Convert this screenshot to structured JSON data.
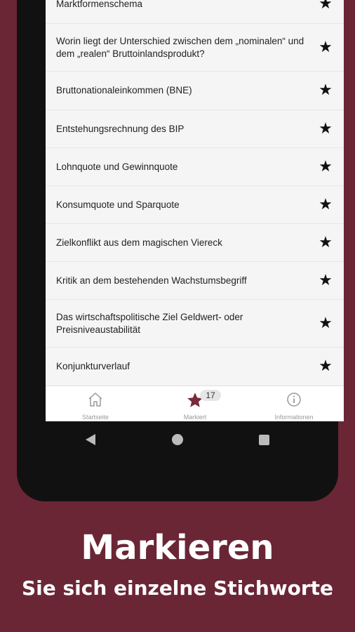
{
  "list": {
    "items": [
      {
        "label": ""
      },
      {
        "label": "Marktformenschema"
      },
      {
        "label": "Worin liegt der Unterschied zwischen dem „nominalen“ und dem „realen“ Bruttoinlandsprodukt?"
      },
      {
        "label": "Bruttonationaleinkommen (BNE)"
      },
      {
        "label": "Entstehungsrechnung des BIP"
      },
      {
        "label": "Lohnquote und Gewinnquote"
      },
      {
        "label": "Konsumquote und Sparquote"
      },
      {
        "label": "Zielkonflikt aus dem magischen Viereck"
      },
      {
        "label": "Kritik an dem bestehenden Wachstumsbegriff"
      },
      {
        "label": "Das wirtschaftspolitische Ziel Geldwert- oder Preisniveaustabilität"
      },
      {
        "label": "Konjunkturverlauf"
      }
    ],
    "star_glyph": "★"
  },
  "tabbar": {
    "tabs": [
      {
        "label": "Startseite",
        "icon": "home-icon"
      },
      {
        "label": "Markiert",
        "icon": "star-icon",
        "badge": "17"
      },
      {
        "label": "Informationen",
        "icon": "info-icon"
      }
    ],
    "active_color": "#7a2a3a",
    "inactive_color": "#999999"
  },
  "promo": {
    "headline": "Markieren",
    "subline": "Sie sich einzelne Stichworte"
  },
  "colors": {
    "background": "#6b2636",
    "list_background": "#f5f5f5"
  }
}
